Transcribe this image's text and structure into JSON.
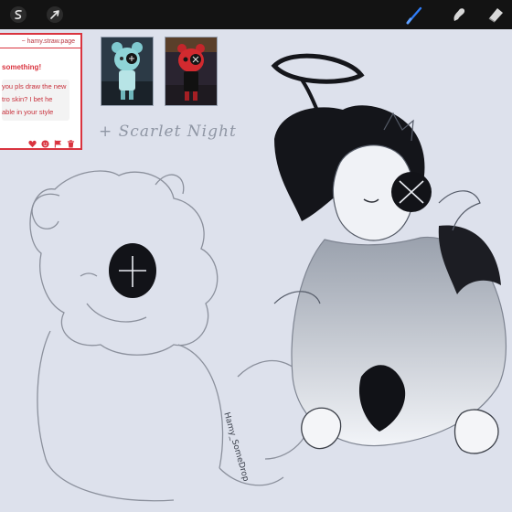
{
  "toolbar": {
    "left_tools": [
      {
        "name": "adjustments-tool",
        "icon": "s-curve-icon"
      },
      {
        "name": "selection-tool",
        "icon": "arrow-cursor-icon"
      }
    ],
    "right_tools": [
      {
        "name": "brush-tool",
        "icon": "brush-icon",
        "active": true
      },
      {
        "name": "smudge-tool",
        "icon": "smudge-icon",
        "active": false
      },
      {
        "name": "eraser-tool",
        "icon": "eraser-icon",
        "active": false
      }
    ],
    "accent_color": "#2f7cf6"
  },
  "ask_card": {
    "username": "~ hamy.straw.page",
    "heading": "something!",
    "message_lines": [
      "you pls draw the new",
      "tro skin? I bet he",
      "able in your style"
    ],
    "action_icons": [
      "heart-icon",
      "smile-icon",
      "flag-icon",
      "trash-icon"
    ],
    "accent": "#d9343f"
  },
  "caption": "+ Scarlet Night",
  "signature": "Hamy_SomeDrop"
}
